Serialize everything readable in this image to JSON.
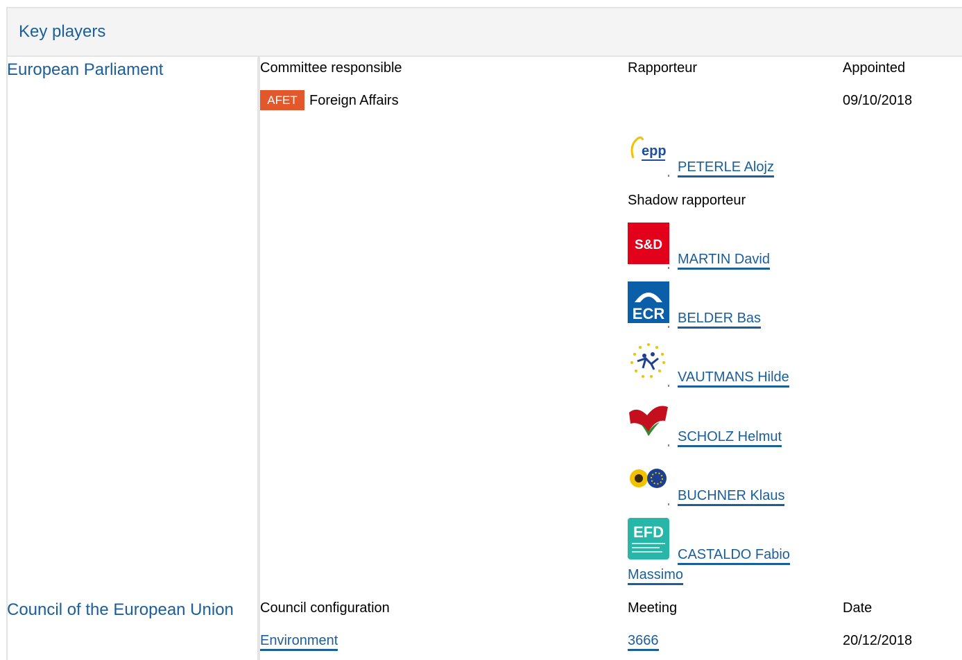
{
  "header": {
    "title": "Key players"
  },
  "parliament": {
    "title": "European Parliament",
    "col_committee": "Committee responsible",
    "col_rapporteur": "Rapporteur",
    "col_appointed": "Appointed",
    "committee_code": "AFET",
    "committee_name": "Foreign Affairs",
    "appointed_date": "09/10/2018",
    "rapporteur": {
      "name": "PETERLE Alojz",
      "group_icon": "epp-logo-icon",
      "logo_text": "epp"
    },
    "shadow_label": "Shadow rapporteur",
    "shadows": [
      {
        "name": "MARTIN David",
        "group_icon": "sd-logo-icon",
        "logo_text": "S&D"
      },
      {
        "name": "BELDER Bas",
        "group_icon": "ecr-logo-icon",
        "logo_text": "ECR"
      },
      {
        "name": "VAUTMANS Hilde",
        "group_icon": "alde-logo-icon"
      },
      {
        "name": "SCHOLZ Helmut",
        "group_icon": "gue-logo-icon"
      },
      {
        "name": "BUCHNER Klaus",
        "group_icon": "greens-logo-icon"
      },
      {
        "name_line1": "CASTALDO Fabio",
        "name_line2": "Massimo",
        "group_icon": "efd-logo-icon",
        "logo_text": "EFD"
      }
    ]
  },
  "council": {
    "title": "Council of the European Union",
    "col_configuration": "Council configuration",
    "col_meeting": "Meeting",
    "col_date": "Date",
    "configuration": "Environment",
    "meeting": "3666",
    "date": "20/12/2018"
  },
  "colors": {
    "link": "#1a5e9a",
    "badge": "#e2582a",
    "header_bg": "#f4f4f4",
    "divider": "#e4e4e4"
  }
}
